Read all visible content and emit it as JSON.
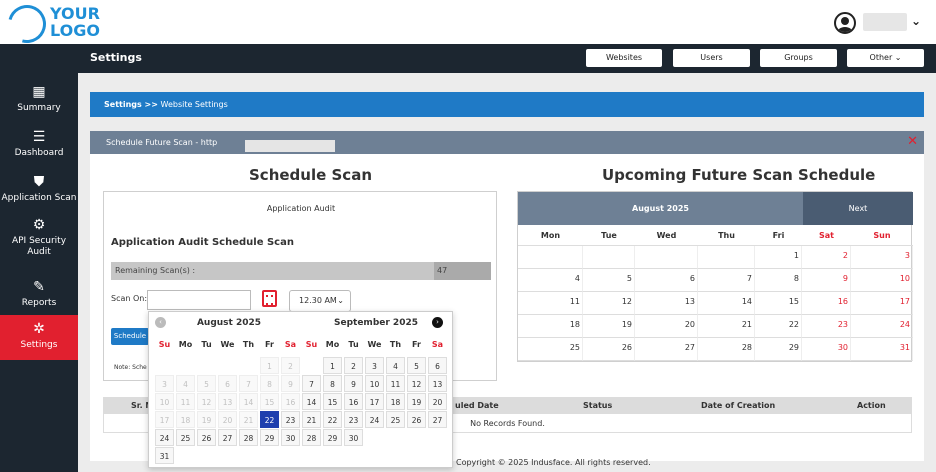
{
  "logo": {
    "line1": "YOUR",
    "line2": "LOGO"
  },
  "user": {
    "chevron": "⌄"
  },
  "sidebar": {
    "items": [
      {
        "label": "Summary",
        "icon": "▦"
      },
      {
        "label": "Dashboard",
        "icon": "☰"
      },
      {
        "label": "Application Scan",
        "icon": "⛊"
      },
      {
        "label": "API Security Audit",
        "icon": "⚙"
      },
      {
        "label": "Reports",
        "icon": "✎"
      },
      {
        "label": "Settings",
        "icon": "✲",
        "active": true
      }
    ]
  },
  "header": {
    "title": "Settings",
    "buttons": [
      "Websites",
      "Users",
      "Groups",
      "Other ⌄"
    ]
  },
  "breadcrumb": {
    "root": "Settings >>",
    "current": "Website Settings"
  },
  "modal": {
    "title": "Schedule Future Scan - http"
  },
  "schedule": {
    "title": "Schedule Scan",
    "subtitle": "Application Audit",
    "heading": "Application Audit Schedule Scan",
    "remaining_label": "Remaining Scan(s) :",
    "remaining_value": "47",
    "scan_on_label": "Scan On:",
    "time_value": "12.30 AM",
    "button": "Schedule",
    "note": "Note: Sche"
  },
  "upcoming": {
    "title": "Upcoming Future Scan Schedule",
    "month": "August 2025",
    "next": "Next",
    "weekdays": [
      "Mon",
      "Tue",
      "Wed",
      "Thu",
      "Fri",
      "Sat",
      "Sun"
    ],
    "weeks": [
      [
        "",
        "",
        "",
        "",
        "1",
        "2",
        "3"
      ],
      [
        "4",
        "5",
        "6",
        "7",
        "8",
        "9",
        "10"
      ],
      [
        "11",
        "12",
        "13",
        "14",
        "15",
        "16",
        "17"
      ],
      [
        "18",
        "19",
        "20",
        "21",
        "22",
        "23",
        "24"
      ],
      [
        "25",
        "26",
        "27",
        "28",
        "29",
        "30",
        "31"
      ]
    ]
  },
  "records": {
    "columns": [
      "Sr. N",
      "uled Date",
      "Status",
      "Date of Creation",
      "Action"
    ],
    "empty": "No Records Found."
  },
  "footer": "Copyright © 2025 Indusface. All rights reserved.",
  "picker": {
    "weekdays": [
      "Su",
      "Mo",
      "Tu",
      "We",
      "Th",
      "Fr",
      "Sa"
    ],
    "months": [
      {
        "title": "August 2025",
        "arrow": "prev",
        "days": [
          [
            "",
            "",
            "",
            "",
            "",
            "1",
            "2"
          ],
          [
            "3",
            "4",
            "5",
            "6",
            "7",
            "8",
            "9"
          ],
          [
            "10",
            "11",
            "12",
            "13",
            "14",
            "15",
            "16"
          ],
          [
            "17",
            "18",
            "19",
            "20",
            "21",
            "22",
            "23"
          ],
          [
            "24",
            "25",
            "26",
            "27",
            "28",
            "29",
            "30"
          ],
          [
            "31",
            "",
            "",
            "",
            "",
            "",
            ""
          ]
        ],
        "disabled_before": 22,
        "selected": "22"
      },
      {
        "title": "September 2025",
        "arrow": "next",
        "days": [
          [
            "",
            "1",
            "2",
            "3",
            "4",
            "5",
            "6"
          ],
          [
            "7",
            "8",
            "9",
            "10",
            "11",
            "12",
            "13"
          ],
          [
            "14",
            "15",
            "16",
            "17",
            "18",
            "19",
            "20"
          ],
          [
            "21",
            "22",
            "23",
            "24",
            "25",
            "26",
            "27"
          ],
          [
            "28",
            "29",
            "30",
            "",
            "",
            "",
            ""
          ]
        ]
      }
    ]
  },
  "colors": {
    "accent": "#1f7ac6",
    "danger": "#e1202f",
    "nav": "#1c2630",
    "selected": "#1e3fae"
  }
}
